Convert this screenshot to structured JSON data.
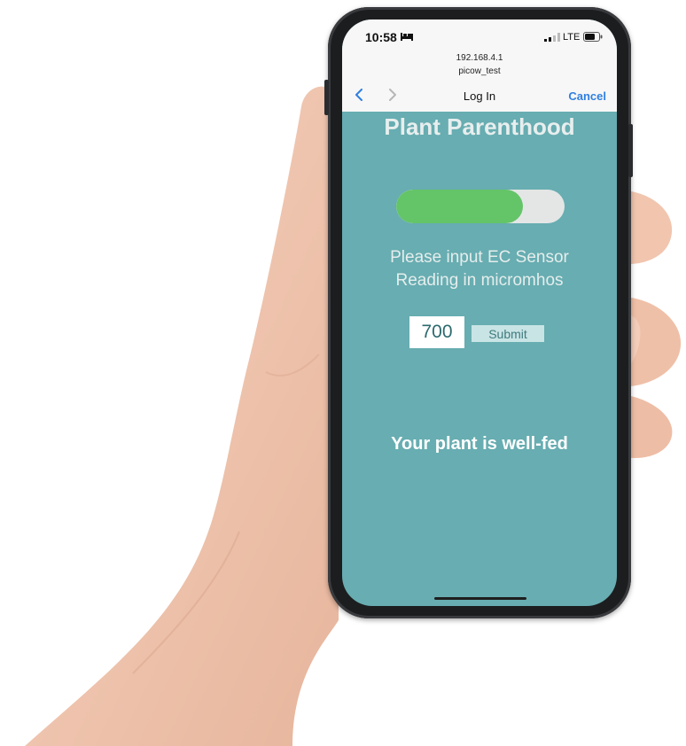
{
  "status_bar": {
    "time": "10:58",
    "network": "LTE",
    "icons": [
      "bed-icon",
      "signal-icon",
      "battery-icon"
    ]
  },
  "browser": {
    "url": "192.168.4.1",
    "subtitle": "picow_test",
    "title": "Log In",
    "cancel_label": "Cancel",
    "icons": [
      "back-icon",
      "forward-icon"
    ],
    "accent_color": "#2f7fe0"
  },
  "page": {
    "title": "Plant Parenthood",
    "progress_fraction": 0.75,
    "prompt_line1": "Please input EC Sensor",
    "prompt_line2": "Reading in micromhos",
    "input_value": "700",
    "submit_label": "Submit",
    "status_message": "Your plant is well-fed",
    "background_color": "#67adb1",
    "progress_color": "#64c468"
  }
}
